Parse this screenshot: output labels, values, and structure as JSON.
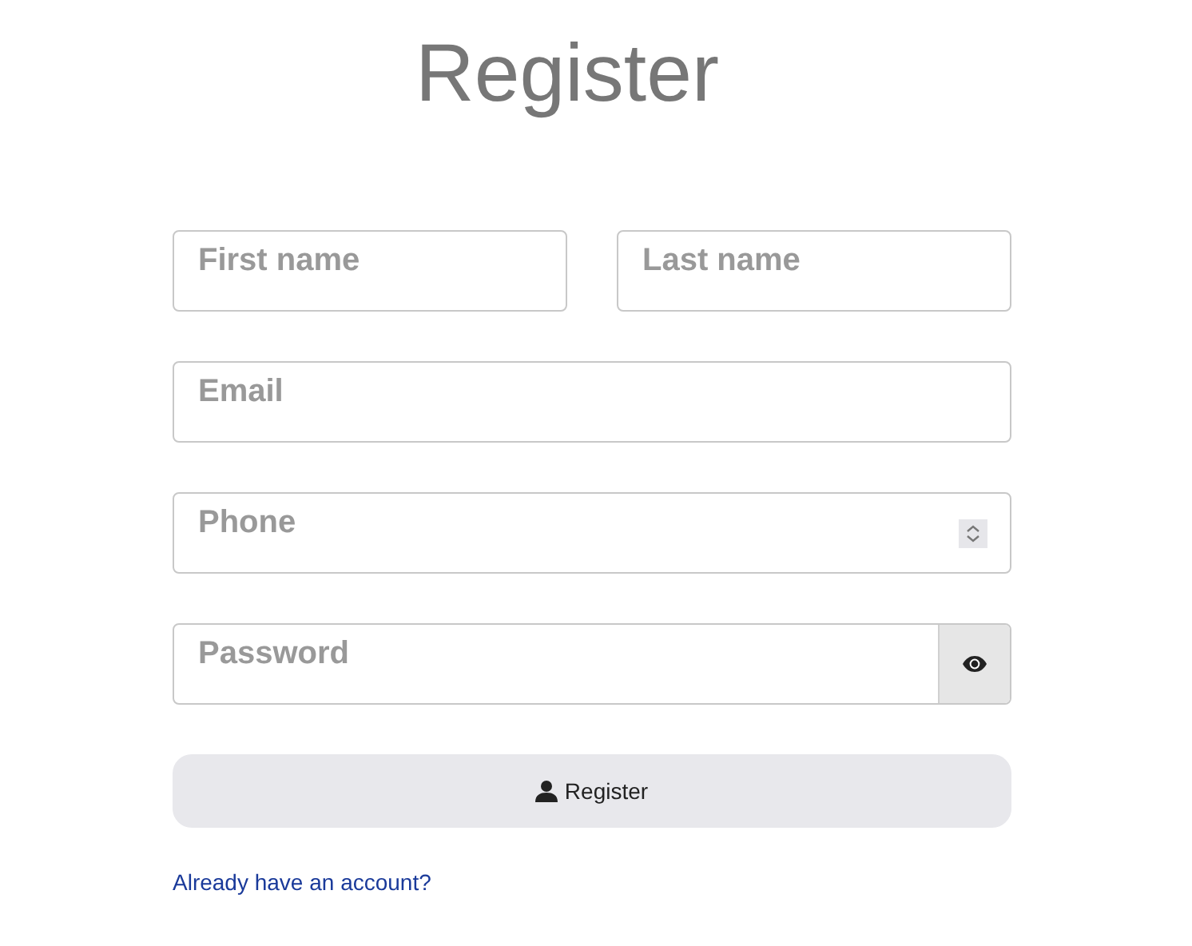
{
  "title": "Register",
  "rows": [
    [
      {
        "placeholder": "First name",
        "kind": "text"
      },
      {
        "placeholder": "Last name",
        "kind": "text"
      }
    ],
    [
      {
        "placeholder": "Email",
        "kind": "text"
      }
    ],
    [
      {
        "placeholder": "Phone",
        "kind": "number"
      }
    ],
    [
      {
        "placeholder": "Password",
        "kind": "password"
      }
    ]
  ],
  "submit": {
    "label": "Register"
  },
  "login_link": "Already have an account?"
}
